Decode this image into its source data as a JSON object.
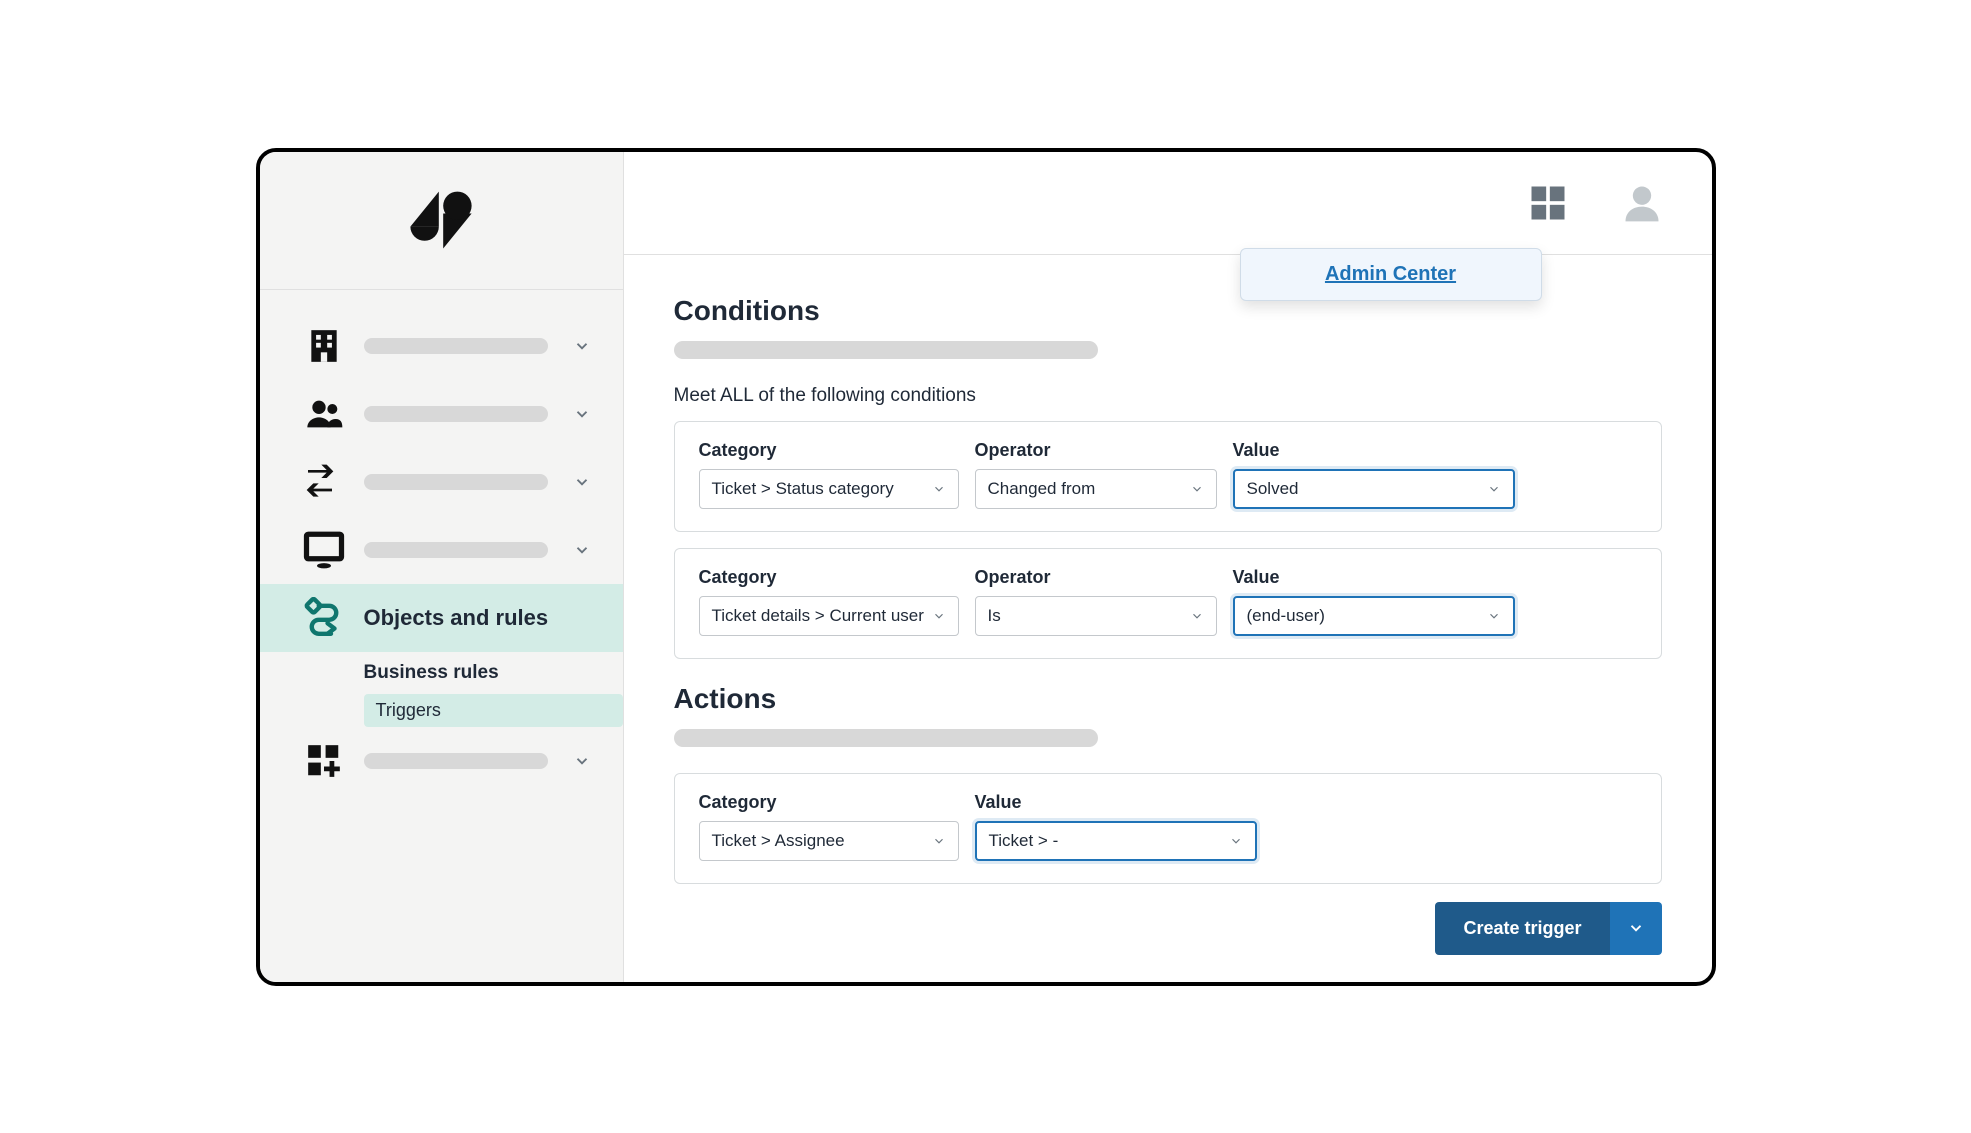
{
  "popover": {
    "label": "Admin Center"
  },
  "sidebar": {
    "active_label": "Objects and rules",
    "subnav": {
      "heading": "Business rules",
      "item": "Triggers"
    }
  },
  "conditions": {
    "title": "Conditions",
    "all_label": "Meet ALL of the following conditions",
    "labels": {
      "category": "Category",
      "operator": "Operator",
      "value": "Value"
    },
    "rows": [
      {
        "category": "Ticket > Status category",
        "operator": "Changed from",
        "value": "Solved"
      },
      {
        "category": "Ticket details > Current user",
        "operator": "Is",
        "value": "(end-user)"
      }
    ]
  },
  "actions": {
    "title": "Actions",
    "labels": {
      "category": "Category",
      "value": "Value"
    },
    "rows": [
      {
        "category": "Ticket > Assignee",
        "value": "Ticket > -"
      }
    ]
  },
  "footer": {
    "create": "Create trigger"
  }
}
